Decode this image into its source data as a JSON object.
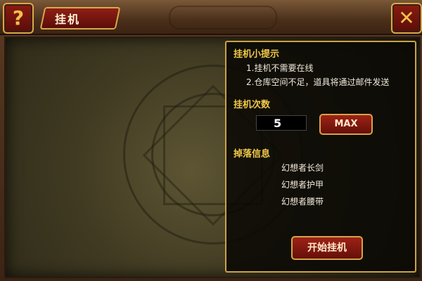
{
  "header": {
    "title": "挂机",
    "help_icon": "?",
    "close_icon": "✕"
  },
  "tips": {
    "title": "挂机小提示",
    "items": [
      "1.挂机不需要在线",
      "2.仓库空间不足，道具将通过邮件发送"
    ]
  },
  "count": {
    "label": "挂机次数",
    "value": "5",
    "max_label": "MAX"
  },
  "drops": {
    "label": "掉落信息",
    "items": [
      "幻想者长剑",
      "幻想者护甲",
      "幻想者腰带"
    ]
  },
  "start_button": "开始挂机",
  "colors": {
    "accent_gold": "#f0c84a",
    "button_red": "#9d2216"
  }
}
